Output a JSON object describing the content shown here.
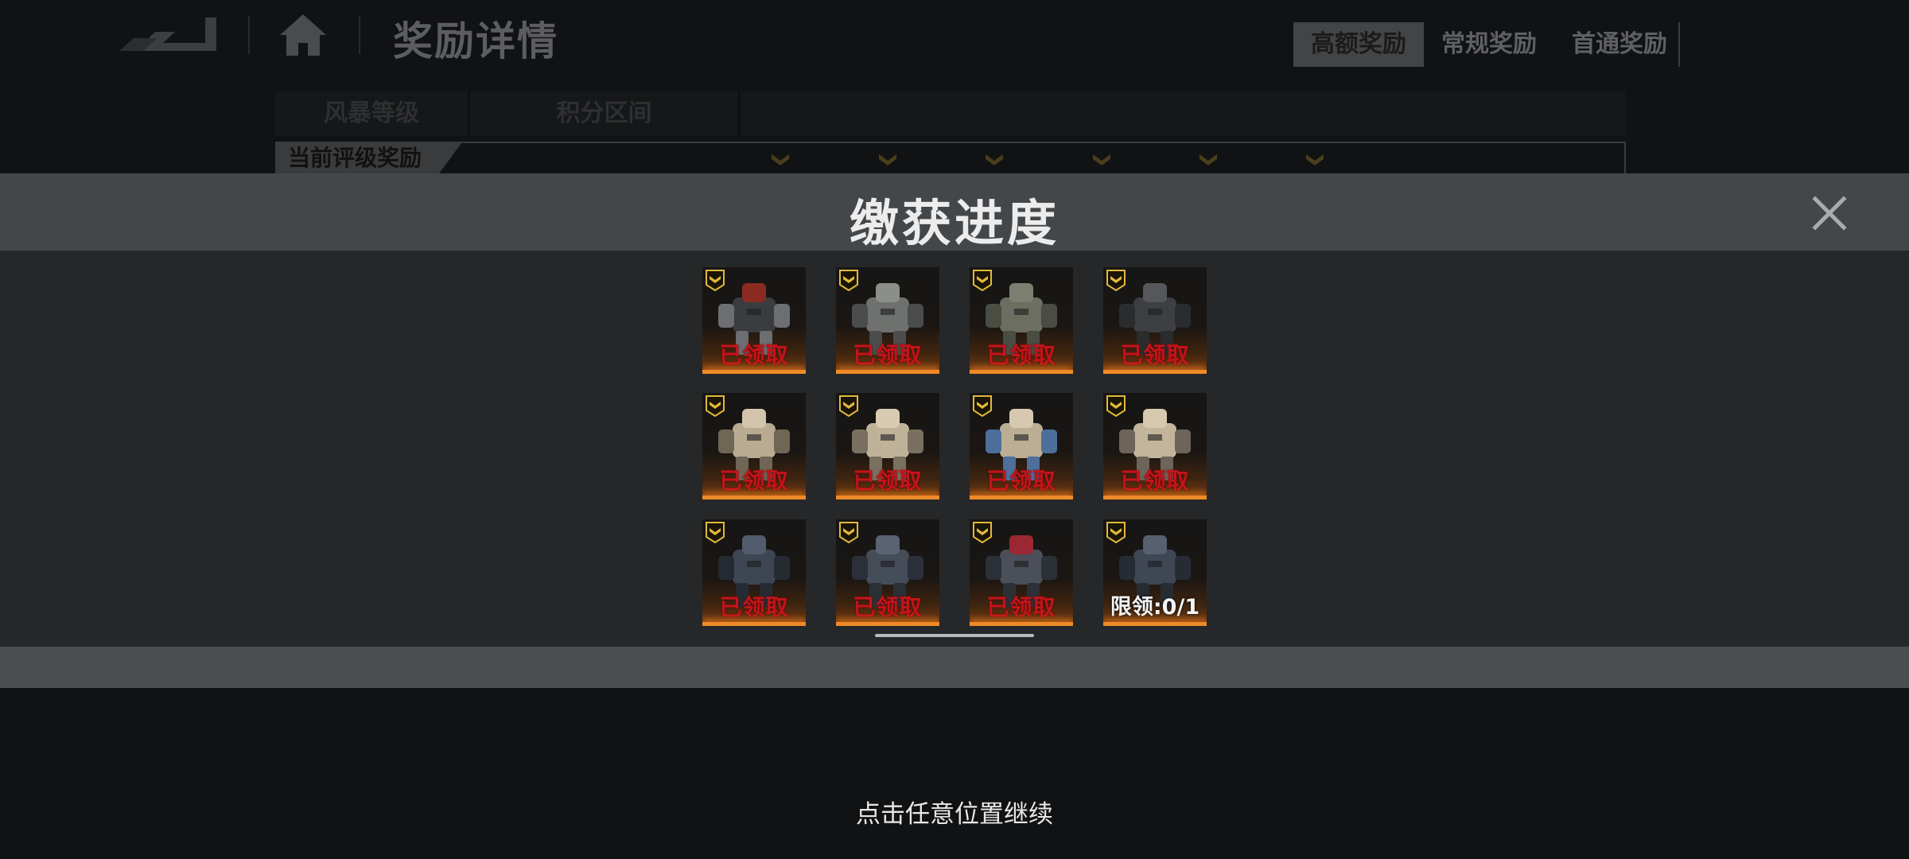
{
  "background": {
    "page_title": "奖励详情",
    "reward_tabs": [
      {
        "label": "高额奖励",
        "active": true
      },
      {
        "label": "常规奖励",
        "active": false
      },
      {
        "label": "首通奖励",
        "active": false
      }
    ],
    "table_headers": [
      "风暴等级",
      "积分区间"
    ],
    "current_row_label": "当前评级奖励"
  },
  "modal": {
    "title": "缴获进度",
    "close_icon": "close-x-icon",
    "items": [
      {
        "mech": "dark-mech-red-head",
        "status": "已领取",
        "state": "claimed"
      },
      {
        "mech": "gray-mech-cannon",
        "status": "已领取",
        "state": "claimed"
      },
      {
        "mech": "olive-mech-walker",
        "status": "已领取",
        "state": "claimed"
      },
      {
        "mech": "dark-mech-standing",
        "status": "已领取",
        "state": "claimed"
      },
      {
        "mech": "tan-mech-heavy",
        "status": "已领取",
        "state": "claimed"
      },
      {
        "mech": "tan-mech-dome",
        "status": "已领取",
        "state": "claimed"
      },
      {
        "mech": "tan-mech-dome-blue",
        "status": "已领取",
        "state": "claimed"
      },
      {
        "mech": "tan-mech-humanoid",
        "status": "已领取",
        "state": "claimed"
      },
      {
        "mech": "navy-mech-antenna",
        "status": "已领取",
        "state": "claimed"
      },
      {
        "mech": "navy-mech-cannon",
        "status": "已领取",
        "state": "claimed"
      },
      {
        "mech": "crimson-mech-turret",
        "status": "已领取",
        "state": "claimed"
      },
      {
        "mech": "navy-mech-standing",
        "status": "限领:0/1",
        "state": "limit"
      }
    ]
  },
  "hint": "点击任意位置继续",
  "colors": {
    "claimed": "#c2141a",
    "rarity_badge": "#e2b93b",
    "glow": "#f08a28",
    "modal_header": "#44474a",
    "modal_body": "#262729"
  }
}
